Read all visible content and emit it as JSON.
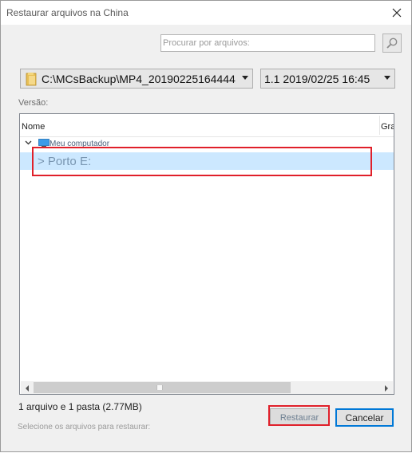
{
  "window": {
    "title": "Restaurar arquivos na China",
    "close_icon": "close-icon"
  },
  "search": {
    "placeholder": "Procurar por arquivos:",
    "icon": "search-icon"
  },
  "backup_path": {
    "value": "C:\\MCsBackup\\MP4_20190225164444",
    "icon": "folder-icon"
  },
  "version": {
    "label": "Versão:",
    "selected": "1.1  2019/02/25 16:45"
  },
  "tree": {
    "columns": {
      "name": "Nome",
      "size": "Grande"
    },
    "root": {
      "label": "Meu computador",
      "icon": "computer-icon"
    },
    "items": [
      {
        "label": "> Porto E:"
      }
    ]
  },
  "status": {
    "summary": "1 arquivo e 1 pasta (2.77MB)",
    "hint": "Selecione os arquivos para restaurar:"
  },
  "buttons": {
    "restore": "Restaurar",
    "cancel": "Cancelar"
  },
  "colors": {
    "selection": "#cce8ff",
    "highlight_annotation": "#e0202a",
    "focus_border": "#0078d7"
  }
}
